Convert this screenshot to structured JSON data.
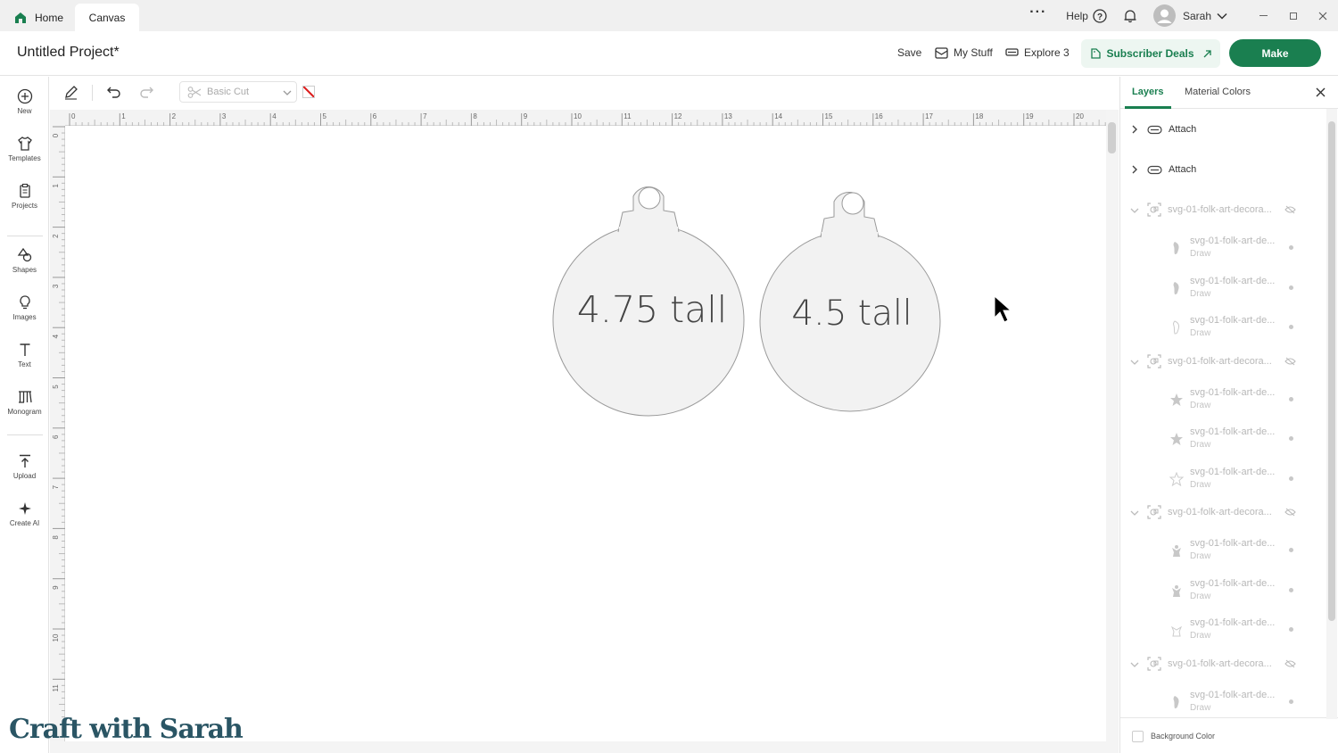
{
  "tabs": {
    "home": "Home",
    "canvas": "Canvas"
  },
  "titlebar": {
    "help": "Help",
    "user": "Sarah"
  },
  "header": {
    "project_title": "Untitled Project*",
    "save": "Save",
    "my_stuff": "My Stuff",
    "machine": "Explore 3",
    "deals": "Subscriber Deals",
    "make": "Make"
  },
  "leftbar": {
    "items": [
      "New",
      "Templates",
      "Projects",
      "Shapes",
      "Images",
      "Text",
      "Monogram",
      "Upload",
      "Create AI"
    ]
  },
  "toolbar": {
    "operation": "Basic Cut"
  },
  "ruler": {
    "top": [
      "0",
      "1",
      "2",
      "3",
      "4",
      "5",
      "6",
      "7",
      "8",
      "9",
      "10",
      "11",
      "12",
      "13",
      "14",
      "15",
      "16",
      "17",
      "18",
      "19",
      "20"
    ],
    "left": [
      "0",
      "1",
      "2",
      "3",
      "4",
      "5",
      "6",
      "7",
      "8",
      "9",
      "10",
      "11"
    ]
  },
  "canvas": {
    "ornament1_text": "4.75  tall",
    "ornament2_text": "4.5  tall"
  },
  "panel": {
    "tabs": {
      "layers": "Layers",
      "colors": "Material Colors"
    },
    "attach": [
      "Attach",
      "Attach"
    ],
    "groups": [
      {
        "name": "svg-01-folk-art-decora...",
        "children": [
          {
            "name": "svg-01-folk-art-de...",
            "type": "Draw"
          },
          {
            "name": "svg-01-folk-art-de...",
            "type": "Draw"
          },
          {
            "name": "svg-01-folk-art-de...",
            "type": "Draw"
          }
        ]
      },
      {
        "name": "svg-01-folk-art-decora...",
        "children": [
          {
            "name": "svg-01-folk-art-de...",
            "type": "Draw"
          },
          {
            "name": "svg-01-folk-art-de...",
            "type": "Draw"
          },
          {
            "name": "svg-01-folk-art-de...",
            "type": "Draw"
          }
        ]
      },
      {
        "name": "svg-01-folk-art-decora...",
        "children": [
          {
            "name": "svg-01-folk-art-de...",
            "type": "Draw"
          },
          {
            "name": "svg-01-folk-art-de...",
            "type": "Draw"
          },
          {
            "name": "svg-01-folk-art-de...",
            "type": "Draw"
          }
        ]
      },
      {
        "name": "svg-01-folk-art-decora...",
        "children": [
          {
            "name": "svg-01-folk-art-de...",
            "type": "Draw"
          }
        ]
      }
    ],
    "background_color": "Background Color"
  },
  "watermark": "Craft with Sarah",
  "colors": {
    "accent": "#1a7f50",
    "deals_bg": "#edf6f1"
  }
}
